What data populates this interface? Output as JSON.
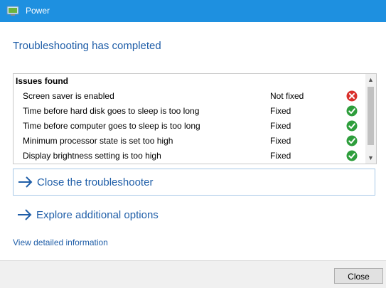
{
  "window": {
    "title": "Power"
  },
  "heading": "Troubleshooting has completed",
  "issues": {
    "header": "Issues found",
    "rows": [
      {
        "name": "Screen saver is enabled",
        "status": "Not fixed",
        "icon": "error-icon",
        "color": "#d9302c"
      },
      {
        "name": "Time before hard disk goes to sleep is too long",
        "status": "Fixed",
        "icon": "check-icon",
        "color": "#2e9e3c"
      },
      {
        "name": "Time before computer goes to sleep is too long",
        "status": "Fixed",
        "icon": "check-icon",
        "color": "#2e9e3c"
      },
      {
        "name": "Minimum processor state is set too high",
        "status": "Fixed",
        "icon": "check-icon",
        "color": "#2e9e3c"
      },
      {
        "name": "Display brightness setting is too high",
        "status": "Fixed",
        "icon": "check-icon",
        "color": "#2e9e3c"
      }
    ]
  },
  "actions": {
    "close_troubleshooter": "Close the troubleshooter",
    "explore_options": "Explore additional options"
  },
  "details_link": "View detailed information",
  "footer": {
    "close_label": "Close"
  },
  "colors": {
    "titlebar": "#1e90e0",
    "link": "#1f5ea8",
    "error": "#d9302c",
    "success": "#2e9e3c"
  }
}
